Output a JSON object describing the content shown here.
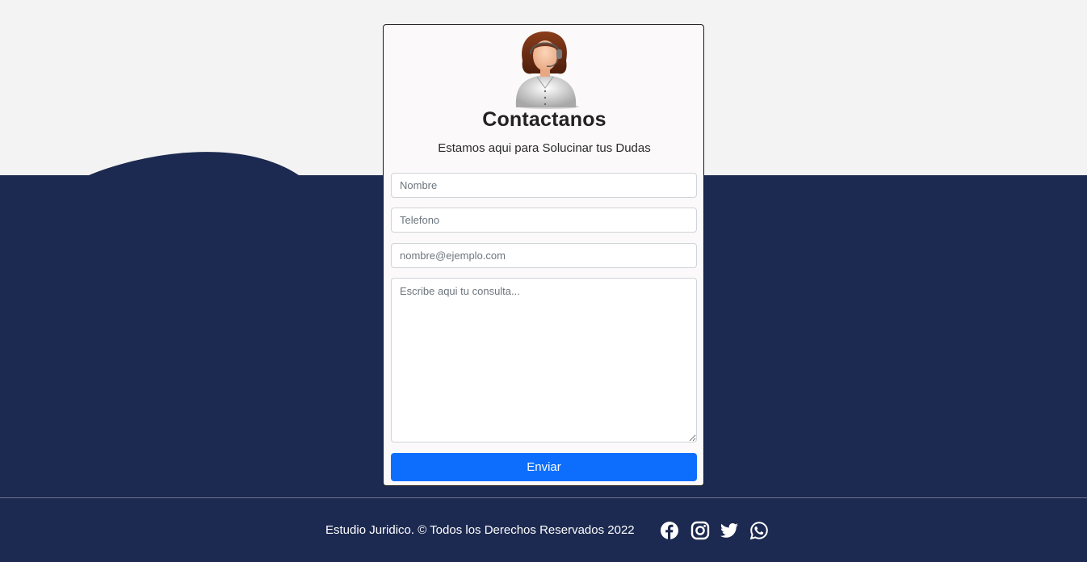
{
  "contact": {
    "title": "Contactanos",
    "subtitle": "Estamos aqui para Solucinar tus Dudas",
    "name_placeholder": "Nombre",
    "phone_placeholder": "Telefono",
    "email_placeholder": "nombre@ejemplo.com",
    "message_placeholder": "Escribe aqui tu consulta...",
    "submit_label": "Enviar"
  },
  "footer": {
    "copyright": "Estudio Juridico. © Todos los Derechos Reservados 2022",
    "social": [
      "facebook-icon",
      "instagram-icon",
      "twitter-icon",
      "whatsapp-icon"
    ]
  },
  "colors": {
    "background": "#f3f3f3",
    "navy": "#1c2950",
    "button": "#0d6efd"
  }
}
